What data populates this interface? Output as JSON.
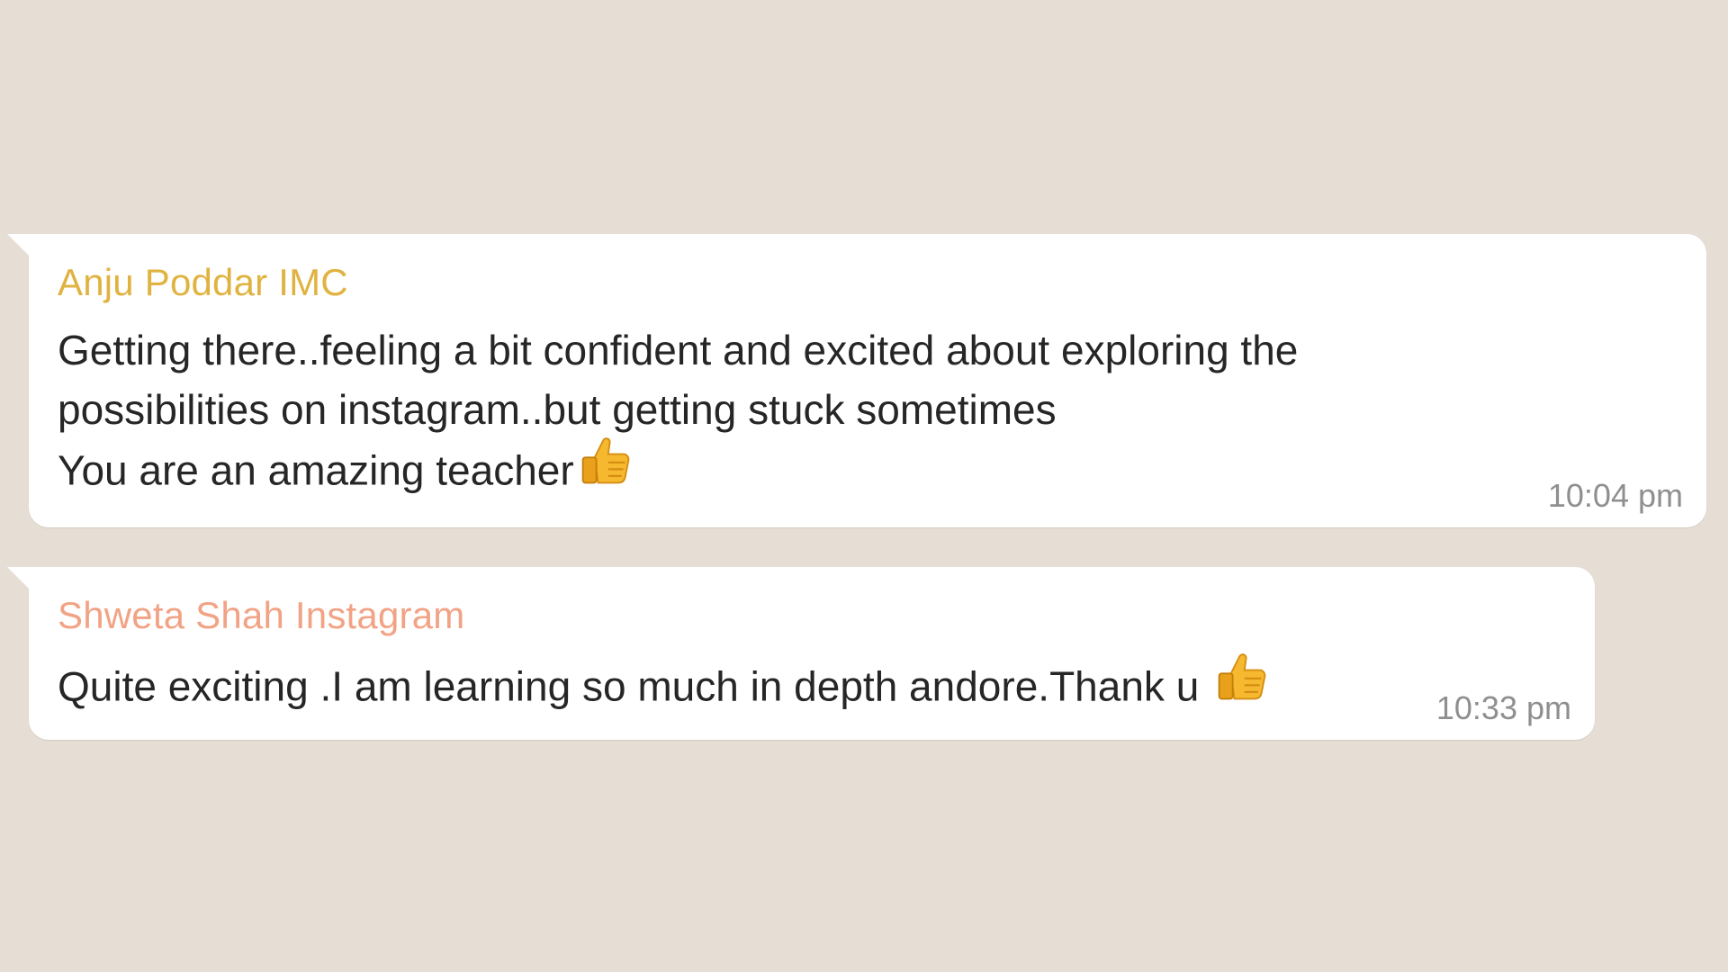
{
  "colors": {
    "background": "#e6ddd4",
    "bubble": "#ffffff",
    "message_text": "#262626",
    "timestamp": "#8f8f8f"
  },
  "messages": [
    {
      "sender": "Anju Poddar IMC",
      "sender_color": "#e0b341",
      "lines": [
        "Getting there..feeling a bit confident and excited about exploring the",
        "possibilities on instagram..but getting stuck sometimes",
        "You are an amazing teacher"
      ],
      "emoji": "thumbs-up-icon",
      "time": "10:04 pm"
    },
    {
      "sender": "Shweta Shah Instagram",
      "sender_color": "#f2a385",
      "lines": [
        "Quite exciting .I am learning so much in depth andore.Thank u "
      ],
      "emoji": "thumbs-up-icon",
      "time": "10:33 pm"
    }
  ]
}
